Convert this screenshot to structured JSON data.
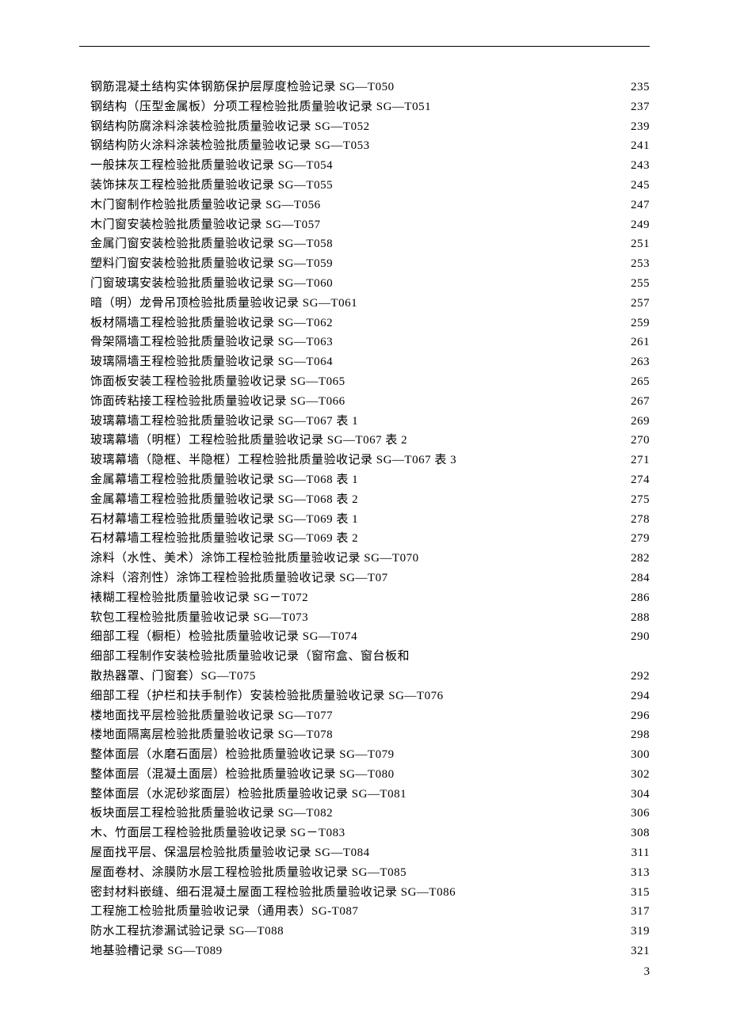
{
  "page_number": "3",
  "toc": [
    {
      "title": "钢筋混凝土结构实体钢筋保护层厚度检验记录 SG—T050",
      "page": "235"
    },
    {
      "title": "钢结构（压型金属板）分项工程检验批质量验收记录 SG—T051",
      "page": "237"
    },
    {
      "title": "钢结构防腐涂料涂装检验批质量验收记录 SG—T052",
      "page": "239"
    },
    {
      "title": "钢结构防火涂料涂装检验批质量验收记录 SG—T053",
      "page": "241"
    },
    {
      "title": "一般抹灰工程检验批质量验收记录 SG—T054",
      "page": "243"
    },
    {
      "title": "装饰抹灰工程检验批质量验收记录 SG—T055",
      "page": "245"
    },
    {
      "title": "木门窗制作检验批质量验收记录 SG—T056",
      "page": "247"
    },
    {
      "title": "木门窗安装检验批质量验收记录 SG—T057",
      "page": "249"
    },
    {
      "title": "金属门窗安装检验批质量验收记录 SG—T058",
      "page": "251"
    },
    {
      "title": "塑料门窗安装检验批质量验收记录 SG—T059",
      "page": "253"
    },
    {
      "title": "门窗玻璃安装检验批质量验收记录 SG—T060",
      "page": "255"
    },
    {
      "title": "暗（明）龙骨吊顶检验批质量验收记录 SG—T061",
      "page": "257"
    },
    {
      "title": "板材隔墙工程检验批质量验收记录 SG—T062",
      "page": "259"
    },
    {
      "title": "骨架隔墙工程检验批质量验收记录 SG—T063",
      "page": "261"
    },
    {
      "title": "玻璃隔墙王程检验批质量验收记录 SG—T064",
      "page": "263"
    },
    {
      "title": "饰面板安装工程检验批质量验收记录 SG—T065",
      "page": "265"
    },
    {
      "title": "饰面砖粘接工程检验批质量验收记录 SG—T066",
      "page": "267"
    },
    {
      "title": "玻璃幕墙工程检验批质量验收记录 SG—T067 表 1",
      "page": "269"
    },
    {
      "title": "玻璃幕墙（明框）工程检验批质量验收记录 SG—T067 表 2",
      "page": "270"
    },
    {
      "title": "玻璃幕墙（隐框、半隐框）工程检验批质量验收记录 SG—T067 表 3",
      "page": "271"
    },
    {
      "title": "金属幕墙工程检验批质量验收记录 SG—T068 表 1",
      "page": "274"
    },
    {
      "title": "金属幕墙工程检验批质量验收记录 SG—T068 表 2",
      "page": "275"
    },
    {
      "title": "石材幕墙工程检验批质量验收记录 SG—T069 表 1",
      "page": "278"
    },
    {
      "title": "石材幕墙工程检验批质量验收记录 SG—T069 表 2",
      "page": "279"
    },
    {
      "title": "涂料（水性、美术）涂饰工程检验批质量验收记录 SG—T070",
      "page": "282"
    },
    {
      "title": "涂料（溶剂性）涂饰工程检验批质量验收记录 SG—T07",
      "page": "284"
    },
    {
      "title": "裱糊工程检验批质量验收记录 SG－T072",
      "page": "286"
    },
    {
      "title": "软包工程检验批质量验收记录 SG—T073",
      "page": "288"
    },
    {
      "title": "细部工程（橱柜）检验批质量验收记录 SG—T074",
      "page": "290"
    },
    {
      "title": "细部工程制作安装检验批质量验收记录（窗帘盒、窗台板和",
      "page": ""
    },
    {
      "title": "散热器罩、门窗套）SG—T075",
      "page": "292"
    },
    {
      "title": "细部工程（护栏和扶手制作）安装检验批质量验收记录 SG—T076",
      "page": "294"
    },
    {
      "title": "楼地面找平层检验批质量验收记录 SG—T077",
      "page": "296"
    },
    {
      "title": "楼地面隔离层检验批质量验收记录 SG—T078",
      "page": "298"
    },
    {
      "title": "整体面层（水磨石面层）检验批质量验收记录 SG—T079",
      "page": "300"
    },
    {
      "title": "整体面层（混凝土面层）检验批质量验收记录 SG—T080",
      "page": "302"
    },
    {
      "title": "整体面层（水泥砂浆面层）检验批质量验收记录 SG—T081",
      "page": "304"
    },
    {
      "title": "板块面层工程检验批质量验收记录 SG—T082",
      "page": "306"
    },
    {
      "title": "木、竹面层工程检验批质量验收记录 SG－T083",
      "page": "308"
    },
    {
      "title": "屋面找平层、保温层检验批质量验收记录 SG—T084",
      "page": "311"
    },
    {
      "title": "屋面卷材、涂膜防水层工程检验批质量验收记录 SG—T085",
      "page": "313"
    },
    {
      "title": "密封材料嵌缝、细石混凝土屋面工程检验批质量验收记录 SG—T086",
      "page": "315"
    },
    {
      "title": "工程施工检验批质量验收记录（通用表）SG-T087",
      "page": "317"
    },
    {
      "title": "防水工程抗渗漏试验记录 SG—T088",
      "page": "319"
    },
    {
      "title": "地基验槽记录 SG—T089",
      "page": "321"
    }
  ]
}
